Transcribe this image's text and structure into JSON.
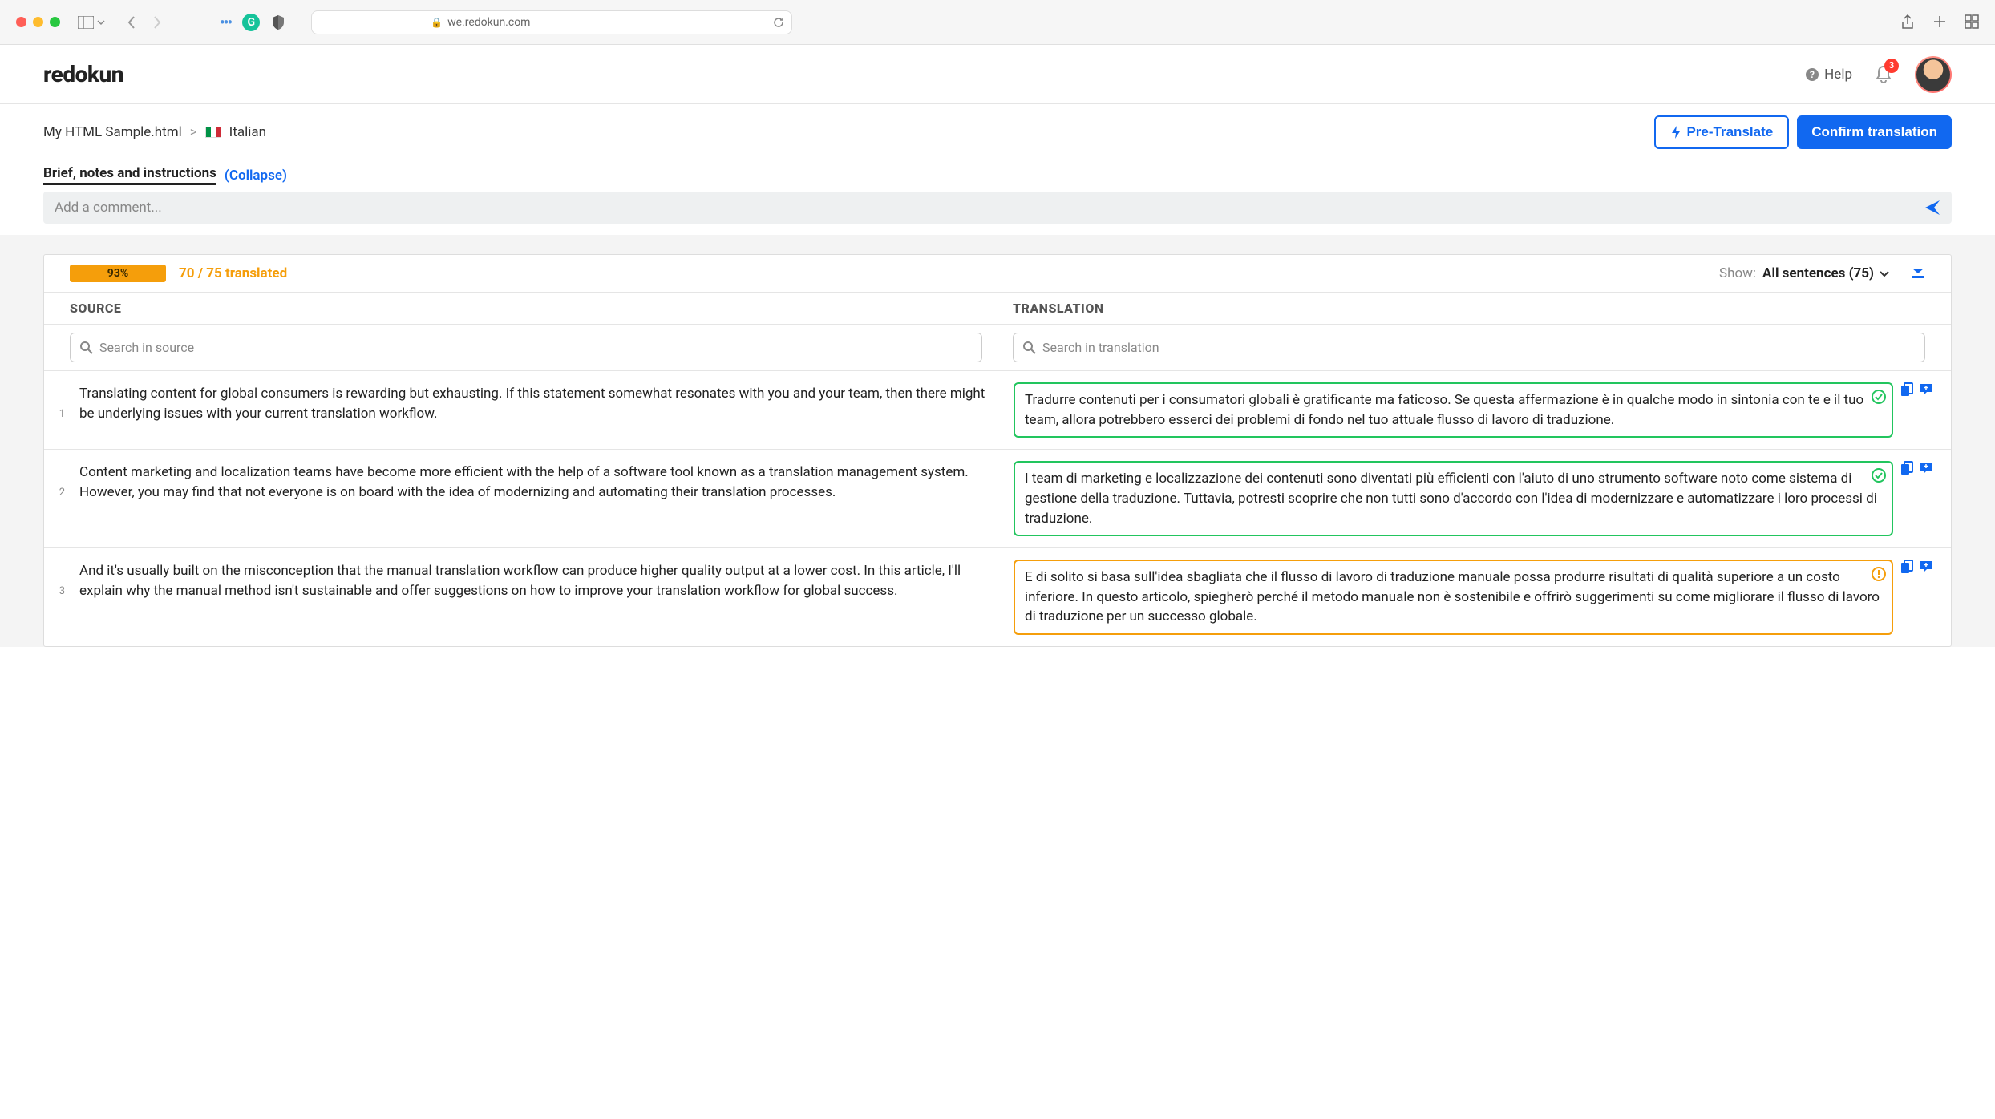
{
  "browser": {
    "url": "we.redokun.com"
  },
  "header": {
    "logo": "redokun",
    "help_label": "Help",
    "notification_count": "3"
  },
  "breadcrumb": {
    "file_name": "My HTML Sample.html",
    "separator": ">",
    "language": "Italian"
  },
  "actions": {
    "pretranslate_label": "Pre-Translate",
    "confirm_label": "Confirm translation"
  },
  "brief": {
    "title": "Brief, notes and instructions",
    "collapse_label": "(Collapse)",
    "comment_placeholder": "Add a comment..."
  },
  "progress": {
    "percent": "93%",
    "count_text": "70 / 75 translated",
    "show_label": "Show:",
    "filter_label": "All sentences (75)"
  },
  "table": {
    "source_header": "SOURCE",
    "translation_header": "TRANSLATION",
    "search_source_placeholder": "Search in source",
    "search_translation_placeholder": "Search in translation"
  },
  "segments": [
    {
      "num": "1",
      "source": "Translating content for global consumers is rewarding but exhausting. If this statement somewhat resonates with you and your team, then there might be underlying issues with your current translation workflow.",
      "translation": "Tradurre contenuti per i consumatori globali è gratificante ma faticoso. Se questa affermazione è in qualche modo in sintonia con te e il tuo team, allora potrebbero esserci dei problemi di fondo nel tuo attuale flusso di lavoro di traduzione.",
      "status": "ok"
    },
    {
      "num": "2",
      "source": "Content marketing and localization teams have become more efficient with the help of a software tool known as a translation management system. However, you may find that not everyone is on board with the idea of modernizing and automating their translation processes.",
      "translation": "I team di marketing e localizzazione dei contenuti sono diventati più efficienti con l'aiuto di uno strumento software noto come sistema di gestione della traduzione. Tuttavia, potresti scoprire che non tutti sono d'accordo con l'idea di modernizzare e automatizzare i loro processi di traduzione.",
      "status": "ok"
    },
    {
      "num": "3",
      "source": "And it's usually built on the misconception that the manual translation workflow can produce higher quality output at a lower cost. In this article, I'll explain why the manual method isn't sustainable and offer suggestions on how to improve your translation workflow for global success.",
      "translation": "E di solito si basa sull'idea sbagliata che il flusso di lavoro di traduzione manuale possa produrre risultati di qualità superiore a un costo inferiore. In questo articolo, spiegherò perché il metodo manuale non è sostenibile e offrirò suggerimenti su come migliorare il flusso di lavoro di traduzione per un successo globale.",
      "status": "warning"
    }
  ]
}
